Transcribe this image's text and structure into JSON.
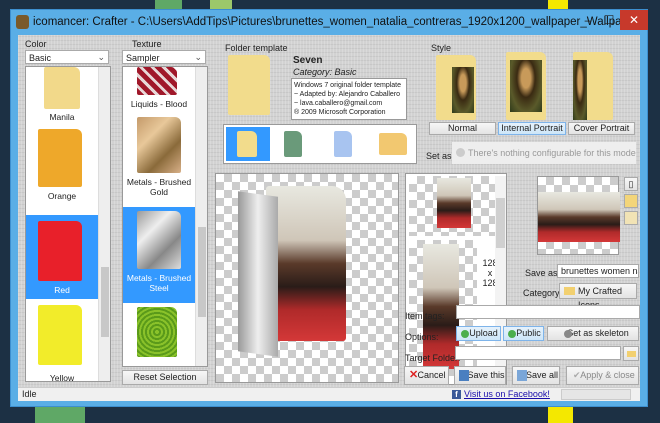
{
  "window": {
    "title": "icomancer: Crafter - C:\\Users\\AddTips\\Pictures\\brunettes_women_natalia_contreras_1920x1200_wallpaper_Wallpap...",
    "minimize": "‒",
    "maximize": "☐",
    "close": "✕"
  },
  "color": {
    "label": "Color",
    "selected": "Basic",
    "items": [
      "Manila",
      "Orange",
      "Red",
      "Yellow"
    ],
    "selected_item": "Red"
  },
  "texture": {
    "label": "Texture",
    "selected": "Sampler",
    "items": [
      "Liquids - Blood",
      "Metals - Brushed Gold",
      "Metals - Brushed Steel",
      ""
    ],
    "selected_item": "Metals - Brushed Steel",
    "reset_label": "Reset Selection"
  },
  "template": {
    "label": "Folder template",
    "name": "Seven",
    "category": "Category: Basic",
    "description": [
      "Windows 7 original folder template",
      "~ Adapted by: Alejandro Caballero",
      "~ lava.caballero@gmail.com",
      "® 2009 Microsoft Corporation"
    ]
  },
  "style": {
    "label": "Style",
    "buttons": [
      "Normal",
      "Internal Portrait",
      "Cover Portrait"
    ],
    "active": "Internal Portrait",
    "set_as_label": "Set as:",
    "set_as_value": "There's nothing configurable for this mode"
  },
  "preview": {
    "size_w": "128",
    "size_x": "x",
    "size_h": "128"
  },
  "form": {
    "save_as_label": "Save as:",
    "save_as_value": "brunettes women natal",
    "category_label": "Category:",
    "category_value": "My Crafted Icons",
    "item_tags_label": "Item tags:",
    "item_tags_value": "",
    "options_label": "Options:",
    "upload": "Upload",
    "public": "Public",
    "skeleton": "Set as skeleton",
    "target_folder_label": "Target Folder:",
    "target_folder_value": ""
  },
  "actions": {
    "cancel": "Cancel",
    "save_this": "Save this",
    "save_all": "Save all",
    "apply_close": "Apply & close"
  },
  "status": {
    "text": "Idle",
    "facebook": "Visit us on Facebook!"
  }
}
